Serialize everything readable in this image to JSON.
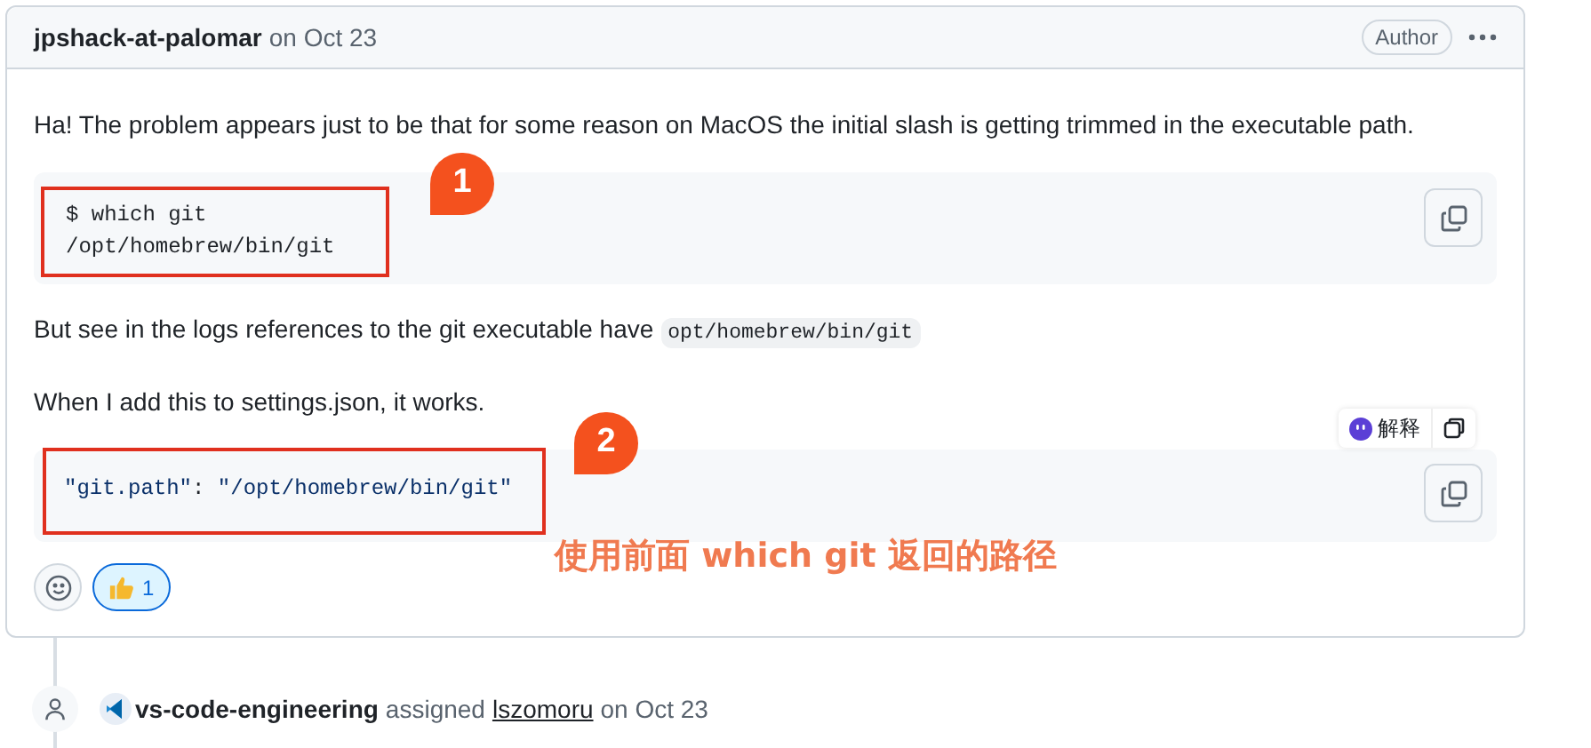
{
  "comment": {
    "author": "jpshack-at-palomar",
    "date": "on Oct 23",
    "badge": "Author"
  },
  "blocks": [
    {
      "kind": "paragraph",
      "text": "Ha! The problem appears just to be that for some reason on MacOS the initial slash is getting trimmed in the executable path."
    },
    {
      "kind": "code",
      "lines": [
        "$ which git",
        "/opt/homebrew/bin/git"
      ]
    },
    {
      "kind": "paragraph",
      "text": "But see in the logs references to the git executable have",
      "code": "opt/homebrew/bin/git"
    },
    {
      "kind": "paragraph",
      "text": "When I add this to settings.json, it works."
    },
    {
      "kind": "json",
      "key": "\"git.path\"",
      "separator": ": ",
      "value": "\"/opt/homebrew/bin/git\""
    }
  ],
  "reactions": [
    {
      "count": "1",
      "selected": true
    }
  ],
  "popup": {
    "label": "解释"
  },
  "annotations": [
    {
      "number": "1"
    },
    {
      "number": "2"
    }
  ],
  "note": "使用前面 which git 返回的路径",
  "event": {
    "actor": "vs-code-engineering",
    "action": "assigned",
    "assignee": "lszomoru",
    "date": "on Oct 23"
  }
}
